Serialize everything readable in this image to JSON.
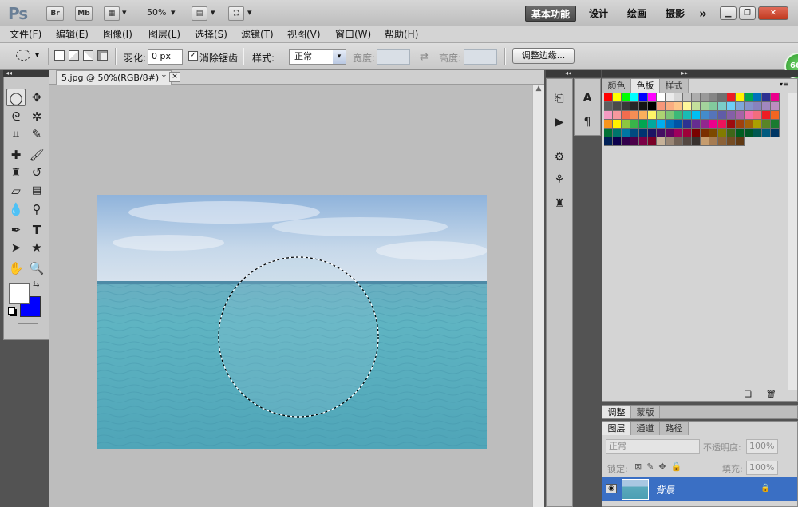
{
  "app": {
    "logo": "Ps",
    "br": "Br",
    "mb": "Mb",
    "zoom": "50%"
  },
  "workspaces": [
    "基本功能",
    "设计",
    "绘画",
    "摄影"
  ],
  "workspace_more": "»",
  "menu": [
    "文件(F)",
    "编辑(E)",
    "图像(I)",
    "图层(L)",
    "选择(S)",
    "滤镜(T)",
    "视图(V)",
    "窗口(W)",
    "帮助(H)"
  ],
  "options": {
    "feather_label": "羽化:",
    "feather_value": "0 px",
    "antialias_label": "消除锯齿",
    "style_label": "样式:",
    "style_value": "正常",
    "width_label": "宽度:",
    "height_label": "高度:",
    "refine_label": "调整边缘..."
  },
  "document": {
    "tab_title": "5.jpg @ 50%(RGB/8#) *",
    "close": "×"
  },
  "swatch_tabs": [
    "颜色",
    "色板",
    "样式"
  ],
  "swatches": [
    "#ff0000",
    "#ffff00",
    "#00ff00",
    "#00ffff",
    "#0000ff",
    "#ff00ff",
    "#ffffff",
    "#ebebeb",
    "#d6d6d6",
    "#c2c2c2",
    "#adadad",
    "#999999",
    "#858585",
    "#707070",
    "#ed1c24",
    "#fff200",
    "#00a651",
    "#0072bc",
    "#2e3192",
    "#ec008c",
    "#5e5e5e",
    "#4a4a4a",
    "#383838",
    "#262626",
    "#141414",
    "#000000",
    "#f7977a",
    "#f9ad81",
    "#fdc68a",
    "#fff79a",
    "#c4df9b",
    "#a3d39c",
    "#82ca9d",
    "#7bcdc8",
    "#6ecff6",
    "#7ea7d8",
    "#8493ca",
    "#8882be",
    "#a187be",
    "#bc8dbf",
    "#f49ac2",
    "#f6989d",
    "#f26c4f",
    "#f68e55",
    "#fbaf5c",
    "#fff467",
    "#acd372",
    "#7cc576",
    "#3bb878",
    "#1abbb4",
    "#00bff3",
    "#438ccb",
    "#5574b9",
    "#605ca8",
    "#855fa8",
    "#a763a8",
    "#f06ea9",
    "#f26d7d",
    "#ed1c24",
    "#f26522",
    "#f7941d",
    "#fff200",
    "#8dc73f",
    "#39b54a",
    "#00a651",
    "#00a99d",
    "#00aeef",
    "#0072bc",
    "#0054a6",
    "#2e3192",
    "#662d91",
    "#92278f",
    "#ec008c",
    "#ed145b",
    "#9e0b0f",
    "#a0410d",
    "#a3620a",
    "#aba000",
    "#598527",
    "#1a7b30",
    "#007236",
    "#00746b",
    "#0076a3",
    "#004b80",
    "#003471",
    "#1b1464",
    "#440e62",
    "#630460",
    "#9e005d",
    "#9e0039",
    "#790000",
    "#7b2e00",
    "#7d4900",
    "#827b00",
    "#406618",
    "#005e20",
    "#005826",
    "#005952",
    "#005b7f",
    "#003663",
    "#002157",
    "#0d004c",
    "#32004b",
    "#4b0049",
    "#7b0046",
    "#7a0026",
    "#c7b299",
    "#998675",
    "#736357",
    "#534741",
    "#37302d",
    "#c69c6e",
    "#a67c52",
    "#8c6239",
    "#754c24",
    "#603913"
  ],
  "panels": {
    "adjust_tabs": [
      "调整",
      "蒙版"
    ],
    "layer_tabs": [
      "图层",
      "通道",
      "路径"
    ]
  },
  "layers": {
    "blend_mode": "正常",
    "opacity_label": "不透明度:",
    "opacity": "100%",
    "lock_label": "锁定:",
    "fill_label": "填充:",
    "fill": "100%",
    "layer_name": "背景"
  },
  "badge": "66",
  "colors": {
    "foreground": "#ffffff",
    "background": "#0000ff",
    "layer_selected": "#3a6fc4"
  }
}
